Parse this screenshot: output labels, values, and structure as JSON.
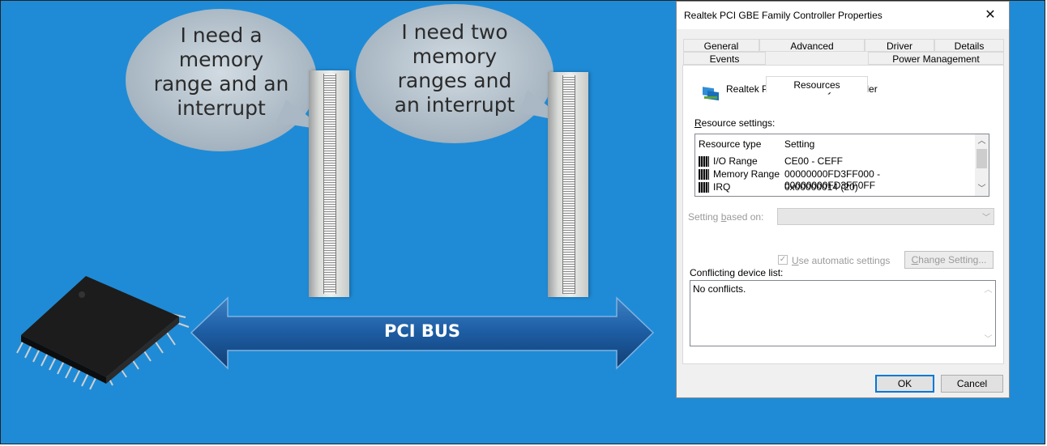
{
  "slide": {
    "bubble1_lines": [
      "I need a",
      "memory",
      "range and an",
      "interrupt"
    ],
    "bubble2_lines": [
      "I need two",
      "memory",
      "ranges and",
      "an interrupt"
    ],
    "bus_label": "PCI BUS",
    "bg_color": "#1f8bd6"
  },
  "dialog": {
    "title": "Realtek PCI GBE Family Controller Properties",
    "close_glyph": "✕",
    "tabs_row1": [
      "General",
      "Advanced",
      "Driver",
      "Details"
    ],
    "tabs_row2": [
      "Events",
      "Resources",
      "Power Management"
    ],
    "active_tab": "Resources",
    "device_name": "Realtek PCI GBE Family Controller",
    "resource_settings_label_pre": "R",
    "resource_settings_label_rest": "esource settings:",
    "grid": {
      "headers": [
        "Resource type",
        "Setting"
      ],
      "rows": [
        {
          "type": "I/O Range",
          "value": "CE00 - CEFF"
        },
        {
          "type": "Memory Range",
          "value": "00000000FD3FF000 - 00000000FD3FF0FF"
        },
        {
          "type": "IRQ",
          "value": "0x00000014 (20)"
        }
      ]
    },
    "setting_based_on_pre": "Setting ",
    "setting_based_on_u": "b",
    "setting_based_on_rest": "ased on:",
    "auto_check_mark": "✓",
    "use_auto_u": "U",
    "use_auto_rest": "se automatic settings",
    "change_setting_u": "C",
    "change_setting_rest": "hange Setting...",
    "conflicting_label": "Conflicting device list:",
    "conflict_text": "No conflicts.",
    "ok_label": "OK",
    "cancel_label": "Cancel"
  }
}
